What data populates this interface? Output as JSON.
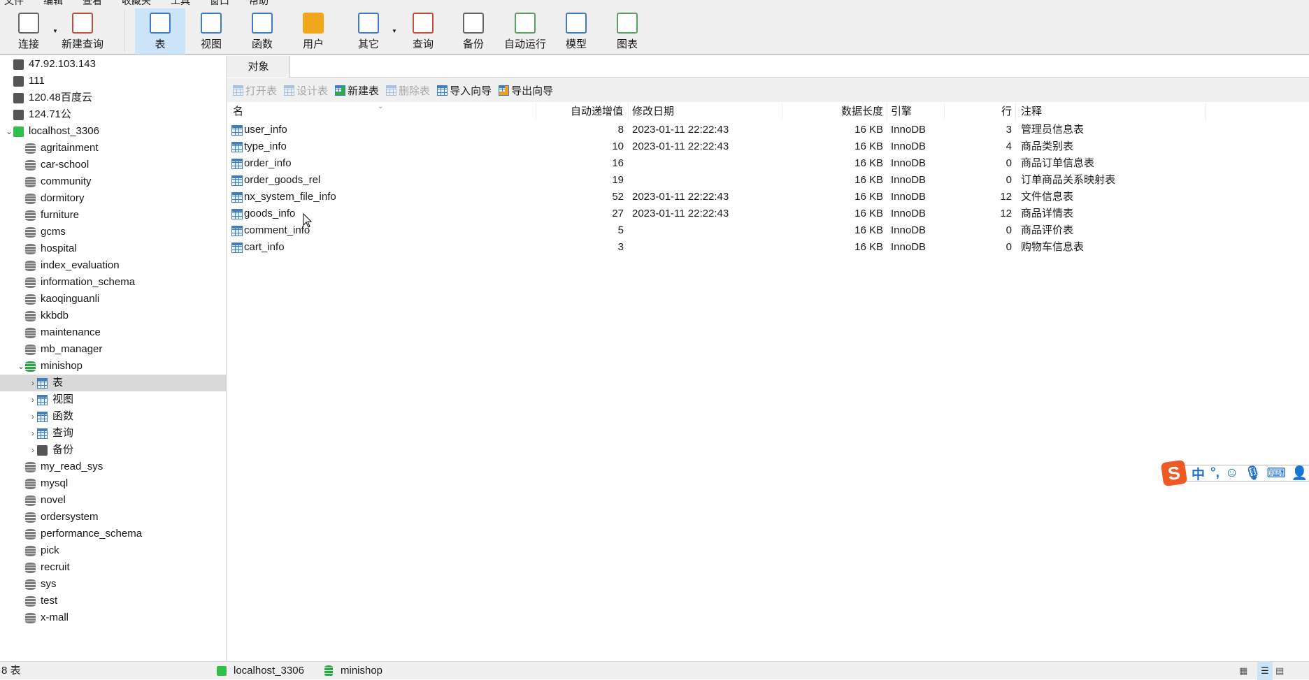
{
  "menu": [
    "文件",
    "编辑",
    "查看",
    "收藏夹",
    "工具",
    "窗口",
    "帮助"
  ],
  "toolbar": [
    {
      "label": "连接",
      "icon": "plug-icon"
    },
    {
      "label": "新建查询",
      "icon": "new-query-icon"
    },
    {
      "label": "表",
      "icon": "table-icon",
      "active": true
    },
    {
      "label": "视图",
      "icon": "view-icon"
    },
    {
      "label": "函数",
      "icon": "function-icon"
    },
    {
      "label": "用户",
      "icon": "user-icon"
    },
    {
      "label": "其它",
      "icon": "tools-icon"
    },
    {
      "label": "查询",
      "icon": "query-icon"
    },
    {
      "label": "备份",
      "icon": "backup-icon"
    },
    {
      "label": "自动运行",
      "icon": "schedule-icon"
    },
    {
      "label": "模型",
      "icon": "model-icon"
    },
    {
      "label": "图表",
      "icon": "chart-icon"
    }
  ],
  "sidebar": {
    "connections": [
      "47.92.103.143",
      "111",
      "120.48百度云",
      "124.71公"
    ],
    "active_connection": "localhost_3306",
    "databases_before": [
      "agritainment",
      "car-school",
      "community",
      "dormitory",
      "furniture",
      "gcms",
      "hospital",
      "index_evaluation",
      "information_schema",
      "kaoqinguanli",
      "kkbdb",
      "maintenance",
      "mb_manager"
    ],
    "open_db": "minishop",
    "open_db_children": [
      "表",
      "视图",
      "函数",
      "查询",
      "备份"
    ],
    "databases_after": [
      "my_read_sys",
      "mysql",
      "novel",
      "ordersystem",
      "performance_schema",
      "pick",
      "recruit",
      "sys",
      "test",
      "x-mall"
    ]
  },
  "tab": "对象",
  "objbar": {
    "open": "打开表",
    "design": "设计表",
    "new": "新建表",
    "delete": "删除表",
    "import": "导入向导",
    "export": "导出向导"
  },
  "columns": [
    "名",
    "自动递增值",
    "修改日期",
    "数据长度",
    "引擎",
    "行",
    "注释"
  ],
  "rows": [
    [
      "user_info",
      "8",
      "2023-01-11 22:22:43",
      "16 KB",
      "InnoDB",
      "3",
      "管理员信息表"
    ],
    [
      "type_info",
      "10",
      "2023-01-11 22:22:43",
      "16 KB",
      "InnoDB",
      "4",
      "商品类别表"
    ],
    [
      "order_info",
      "16",
      "",
      "16 KB",
      "InnoDB",
      "0",
      "商品订单信息表"
    ],
    [
      "order_goods_rel",
      "19",
      "",
      "16 KB",
      "InnoDB",
      "0",
      "订单商品关系映射表"
    ],
    [
      "nx_system_file_info",
      "52",
      "2023-01-11 22:22:43",
      "16 KB",
      "InnoDB",
      "12",
      "文件信息表"
    ],
    [
      "goods_info",
      "27",
      "2023-01-11 22:22:43",
      "16 KB",
      "InnoDB",
      "12",
      "商品详情表"
    ],
    [
      "comment_info",
      "5",
      "",
      "16 KB",
      "InnoDB",
      "0",
      "商品评价表"
    ],
    [
      "cart_info",
      "3",
      "",
      "16 KB",
      "InnoDB",
      "0",
      "购物车信息表"
    ]
  ],
  "status": {
    "count": "8 表",
    "connection": "localhost_3306",
    "database": "minishop"
  },
  "ime": {
    "logo": "S",
    "mode": "中",
    "punct": "°,"
  }
}
